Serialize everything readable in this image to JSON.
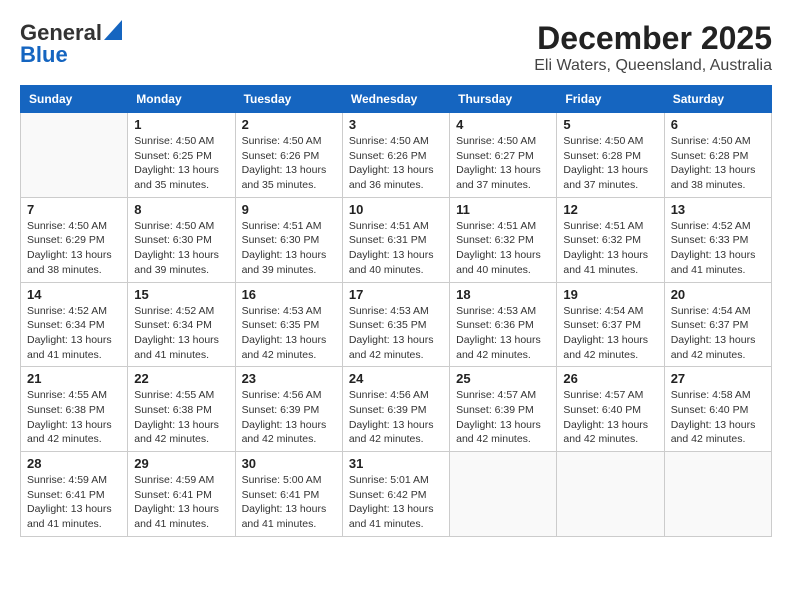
{
  "logo": {
    "line1": "General",
    "line2": "Blue"
  },
  "title": {
    "month_year": "December 2025",
    "location": "Eli Waters, Queensland, Australia"
  },
  "days_of_week": [
    "Sunday",
    "Monday",
    "Tuesday",
    "Wednesday",
    "Thursday",
    "Friday",
    "Saturday"
  ],
  "weeks": [
    [
      {
        "day": "",
        "info": ""
      },
      {
        "day": "1",
        "info": "Sunrise: 4:50 AM\nSunset: 6:25 PM\nDaylight: 13 hours\nand 35 minutes."
      },
      {
        "day": "2",
        "info": "Sunrise: 4:50 AM\nSunset: 6:26 PM\nDaylight: 13 hours\nand 35 minutes."
      },
      {
        "day": "3",
        "info": "Sunrise: 4:50 AM\nSunset: 6:26 PM\nDaylight: 13 hours\nand 36 minutes."
      },
      {
        "day": "4",
        "info": "Sunrise: 4:50 AM\nSunset: 6:27 PM\nDaylight: 13 hours\nand 37 minutes."
      },
      {
        "day": "5",
        "info": "Sunrise: 4:50 AM\nSunset: 6:28 PM\nDaylight: 13 hours\nand 37 minutes."
      },
      {
        "day": "6",
        "info": "Sunrise: 4:50 AM\nSunset: 6:28 PM\nDaylight: 13 hours\nand 38 minutes."
      }
    ],
    [
      {
        "day": "7",
        "info": "Sunrise: 4:50 AM\nSunset: 6:29 PM\nDaylight: 13 hours\nand 38 minutes."
      },
      {
        "day": "8",
        "info": "Sunrise: 4:50 AM\nSunset: 6:30 PM\nDaylight: 13 hours\nand 39 minutes."
      },
      {
        "day": "9",
        "info": "Sunrise: 4:51 AM\nSunset: 6:30 PM\nDaylight: 13 hours\nand 39 minutes."
      },
      {
        "day": "10",
        "info": "Sunrise: 4:51 AM\nSunset: 6:31 PM\nDaylight: 13 hours\nand 40 minutes."
      },
      {
        "day": "11",
        "info": "Sunrise: 4:51 AM\nSunset: 6:32 PM\nDaylight: 13 hours\nand 40 minutes."
      },
      {
        "day": "12",
        "info": "Sunrise: 4:51 AM\nSunset: 6:32 PM\nDaylight: 13 hours\nand 41 minutes."
      },
      {
        "day": "13",
        "info": "Sunrise: 4:52 AM\nSunset: 6:33 PM\nDaylight: 13 hours\nand 41 minutes."
      }
    ],
    [
      {
        "day": "14",
        "info": "Sunrise: 4:52 AM\nSunset: 6:34 PM\nDaylight: 13 hours\nand 41 minutes."
      },
      {
        "day": "15",
        "info": "Sunrise: 4:52 AM\nSunset: 6:34 PM\nDaylight: 13 hours\nand 41 minutes."
      },
      {
        "day": "16",
        "info": "Sunrise: 4:53 AM\nSunset: 6:35 PM\nDaylight: 13 hours\nand 42 minutes."
      },
      {
        "day": "17",
        "info": "Sunrise: 4:53 AM\nSunset: 6:35 PM\nDaylight: 13 hours\nand 42 minutes."
      },
      {
        "day": "18",
        "info": "Sunrise: 4:53 AM\nSunset: 6:36 PM\nDaylight: 13 hours\nand 42 minutes."
      },
      {
        "day": "19",
        "info": "Sunrise: 4:54 AM\nSunset: 6:37 PM\nDaylight: 13 hours\nand 42 minutes."
      },
      {
        "day": "20",
        "info": "Sunrise: 4:54 AM\nSunset: 6:37 PM\nDaylight: 13 hours\nand 42 minutes."
      }
    ],
    [
      {
        "day": "21",
        "info": "Sunrise: 4:55 AM\nSunset: 6:38 PM\nDaylight: 13 hours\nand 42 minutes."
      },
      {
        "day": "22",
        "info": "Sunrise: 4:55 AM\nSunset: 6:38 PM\nDaylight: 13 hours\nand 42 minutes."
      },
      {
        "day": "23",
        "info": "Sunrise: 4:56 AM\nSunset: 6:39 PM\nDaylight: 13 hours\nand 42 minutes."
      },
      {
        "day": "24",
        "info": "Sunrise: 4:56 AM\nSunset: 6:39 PM\nDaylight: 13 hours\nand 42 minutes."
      },
      {
        "day": "25",
        "info": "Sunrise: 4:57 AM\nSunset: 6:39 PM\nDaylight: 13 hours\nand 42 minutes."
      },
      {
        "day": "26",
        "info": "Sunrise: 4:57 AM\nSunset: 6:40 PM\nDaylight: 13 hours\nand 42 minutes."
      },
      {
        "day": "27",
        "info": "Sunrise: 4:58 AM\nSunset: 6:40 PM\nDaylight: 13 hours\nand 42 minutes."
      }
    ],
    [
      {
        "day": "28",
        "info": "Sunrise: 4:59 AM\nSunset: 6:41 PM\nDaylight: 13 hours\nand 41 minutes."
      },
      {
        "day": "29",
        "info": "Sunrise: 4:59 AM\nSunset: 6:41 PM\nDaylight: 13 hours\nand 41 minutes."
      },
      {
        "day": "30",
        "info": "Sunrise: 5:00 AM\nSunset: 6:41 PM\nDaylight: 13 hours\nand 41 minutes."
      },
      {
        "day": "31",
        "info": "Sunrise: 5:01 AM\nSunset: 6:42 PM\nDaylight: 13 hours\nand 41 minutes."
      },
      {
        "day": "",
        "info": ""
      },
      {
        "day": "",
        "info": ""
      },
      {
        "day": "",
        "info": ""
      }
    ]
  ]
}
